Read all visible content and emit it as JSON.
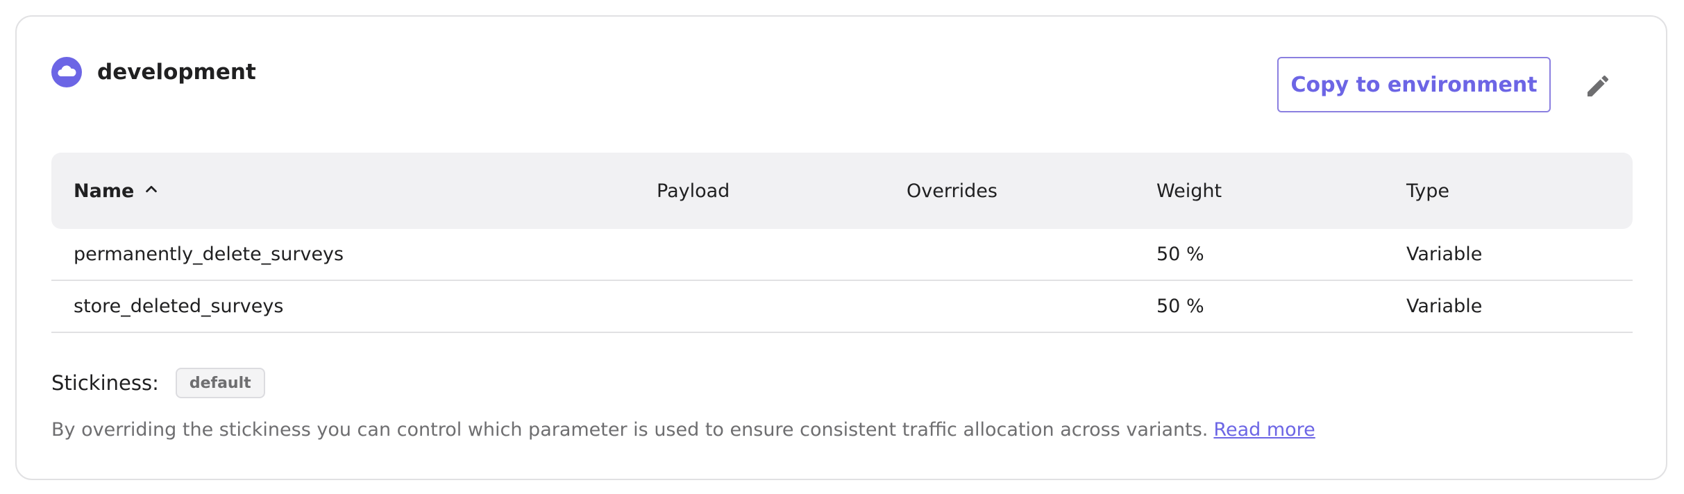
{
  "environment": {
    "name": "development",
    "icon": "cloud-icon",
    "accent_color": "#6c65e5"
  },
  "actions": {
    "copy_label": "Copy to environment",
    "edit_icon": "pencil-icon"
  },
  "table": {
    "columns": {
      "name": "Name",
      "payload": "Payload",
      "overrides": "Overrides",
      "weight": "Weight",
      "type": "Type"
    },
    "sort": {
      "column": "name",
      "direction": "ascending",
      "icon": "chevron-up-icon"
    },
    "rows": [
      {
        "name": "permanently_delete_surveys",
        "payload": "",
        "overrides": "",
        "weight": "50 %",
        "type": "Variable"
      },
      {
        "name": "store_deleted_surveys",
        "payload": "",
        "overrides": "",
        "weight": "50 %",
        "type": "Variable"
      }
    ]
  },
  "stickiness": {
    "label": "Stickiness:",
    "value": "default",
    "description": "By overriding the stickiness you can control which parameter is used to ensure consistent traffic allocation across variants.",
    "link_label": "Read more"
  }
}
